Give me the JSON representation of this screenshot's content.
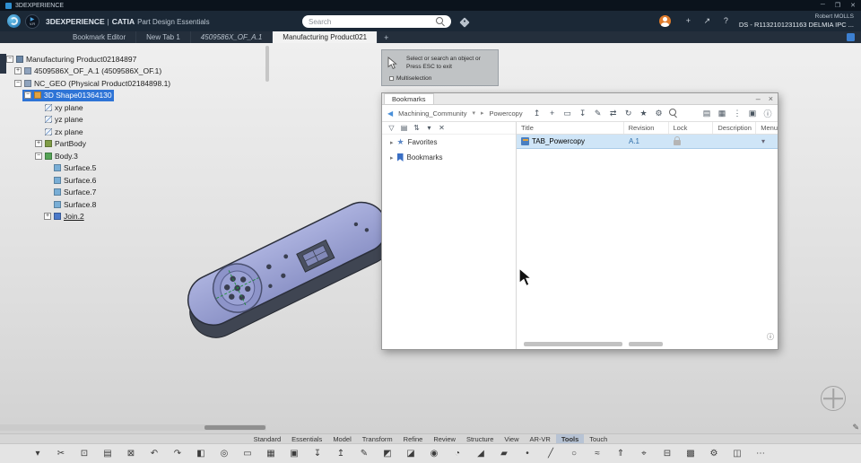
{
  "titlebar": {
    "app_name": "3DEXPERIENCE",
    "minimize": "─",
    "maximize": "❐",
    "close": "✕"
  },
  "header": {
    "brand": "3DEXPERIENCE",
    "divider": "|",
    "app": "CATIA",
    "module": "Part Design Essentials",
    "play_label": "V.R",
    "play_glyph": "▶",
    "search_placeholder": "Search",
    "user_name": "Robert MOLLS",
    "server_id": "DS - R1132101231163 DELMIA IPC ...",
    "actions": [
      {
        "glyph": "+",
        "name": "add-icon"
      },
      {
        "glyph": "↗",
        "name": "share-icon"
      },
      {
        "glyph": "?",
        "name": "help-icon"
      }
    ]
  },
  "tabbar": {
    "tabs": [
      {
        "label": "Bookmark Editor",
        "cls": ""
      },
      {
        "label": "New Tab 1",
        "cls": ""
      },
      {
        "label": "4509586X_OF_A.1",
        "cls": "italic"
      },
      {
        "label": "Manufacturing Product021",
        "cls": "active"
      }
    ],
    "new_tab": "+"
  },
  "tooltip": {
    "line1": "Select or search an object or",
    "line2": "Press ESC to exit",
    "checkbox_label": "Multiselection"
  },
  "tree": {
    "items": [
      {
        "label": "Manufacturing Product02184897",
        "exp": "−",
        "expcls": "box",
        "icon": "ic-root",
        "cls": "lvl0"
      },
      {
        "label": "4509586X_OF_A.1 (4509586X_OF.1)",
        "exp": "+",
        "expcls": "box",
        "icon": "ic-product",
        "cls": "lvl1"
      },
      {
        "label": "NC_GEO (Physical Product02184898.1)",
        "exp": "−",
        "expcls": "box",
        "icon": "ic-product",
        "cls": "lvl1"
      },
      {
        "label": "3D Shape01364130",
        "exp": "−",
        "expcls": "box",
        "icon": "ic-shape",
        "cls": "lvl2 selected"
      },
      {
        "label": "xy plane",
        "exp": "",
        "expcls": "hid",
        "icon": "ic-plane",
        "cls": "lvl3"
      },
      {
        "label": "yz plane",
        "exp": "",
        "expcls": "hid",
        "icon": "ic-plane",
        "cls": "lvl3"
      },
      {
        "label": "zx plane",
        "exp": "",
        "expcls": "hid",
        "icon": "ic-plane",
        "cls": "lvl3"
      },
      {
        "label": "PartBody",
        "exp": "+",
        "expcls": "box",
        "icon": "ic-partbody",
        "cls": "lvl3"
      },
      {
        "label": "Body.3",
        "exp": "−",
        "expcls": "box",
        "icon": "ic-body",
        "cls": "lvl3"
      },
      {
        "label": "Surface.5",
        "exp": "",
        "expcls": "hid",
        "icon": "ic-surface",
        "cls": "lvl4"
      },
      {
        "label": "Surface.6",
        "exp": "",
        "expcls": "hid",
        "icon": "ic-surface",
        "cls": "lvl4"
      },
      {
        "label": "Surface.7",
        "exp": "",
        "expcls": "hid",
        "icon": "ic-surface",
        "cls": "lvl4"
      },
      {
        "label": "Surface.8",
        "exp": "",
        "expcls": "hid",
        "icon": "ic-surface",
        "cls": "lvl4"
      },
      {
        "label": "Join.2",
        "exp": "+",
        "expcls": "box",
        "icon": "ic-join",
        "cls": "lvl4 link"
      }
    ]
  },
  "panel": {
    "title": "Bookmarks",
    "minimize": "–",
    "close": "×",
    "back": "◀",
    "breadcrumb": {
      "root": "Machining_Community",
      "caret": "▾",
      "sep": "▸",
      "current": "Powercopy"
    },
    "toolbar_icons": [
      {
        "glyph": "↥",
        "name": "upload-icon"
      },
      {
        "glyph": "+",
        "name": "add-icon"
      },
      {
        "glyph": "▭",
        "name": "new-folder-icon"
      },
      {
        "glyph": "↧",
        "name": "download-icon"
      },
      {
        "glyph": "✎",
        "name": "edit-icon"
      },
      {
        "glyph": "⇄",
        "name": "transfer-icon"
      },
      {
        "glyph": "↻",
        "name": "refresh-icon"
      },
      {
        "glyph": "★",
        "name": "favorite-icon"
      },
      {
        "glyph": "⚙",
        "name": "settings-icon"
      }
    ],
    "toolbar_icons2": [
      {
        "glyph": "▤",
        "name": "list-view-icon"
      },
      {
        "glyph": "▦",
        "name": "grid-view-icon"
      },
      {
        "glyph": "⋮",
        "name": "more-icon"
      },
      {
        "glyph": "▣",
        "name": "tile-view-icon"
      },
      {
        "glyph": "ⓘ",
        "name": "info-icon"
      }
    ],
    "filter_icons": [
      {
        "glyph": "▽",
        "name": "filter-icon"
      },
      {
        "glyph": "▤",
        "name": "group-icon"
      },
      {
        "glyph": "⇅",
        "name": "sort-icon"
      },
      {
        "glyph": "▾",
        "name": "sort-options-icon"
      },
      {
        "glyph": "✕",
        "name": "clear-filter-icon"
      }
    ],
    "columns": [
      "Title",
      "Revision",
      "Lock",
      "Description",
      "Menu"
    ],
    "nav": [
      {
        "exp": "▸",
        "label": "Favorites"
      },
      {
        "exp": "▸",
        "label": "Bookmarks"
      }
    ],
    "rows": [
      {
        "title": "TAB_Powercopy",
        "revision": "A.1",
        "menu": "▾"
      }
    ],
    "info_glyph": "ⓘ"
  },
  "ribbon": {
    "sections": [
      {
        "label": "Standard",
        "cls": ""
      },
      {
        "label": "Essentials",
        "cls": ""
      },
      {
        "label": "Model",
        "cls": ""
      },
      {
        "label": "Transform",
        "cls": ""
      },
      {
        "label": "Refine",
        "cls": ""
      },
      {
        "label": "Review",
        "cls": ""
      },
      {
        "label": "Structure",
        "cls": ""
      },
      {
        "label": "View",
        "cls": ""
      },
      {
        "label": "AR-VR",
        "cls": ""
      },
      {
        "label": "Tools",
        "cls": "active"
      },
      {
        "label": "Touch",
        "cls": ""
      }
    ]
  },
  "toolbar": {
    "icons": [
      {
        "glyph": "▾",
        "name": "options-chevron-icon"
      },
      {
        "glyph": "✂",
        "name": "cut-icon"
      },
      {
        "glyph": "⊡",
        "name": "copy-icon"
      },
      {
        "glyph": "▤",
        "name": "paste-icon"
      },
      {
        "glyph": "⊠",
        "name": "delete-icon"
      },
      {
        "glyph": "↶",
        "name": "undo-icon"
      },
      {
        "glyph": "↷",
        "name": "redo-icon"
      },
      {
        "glyph": "◧",
        "name": "paint-icon"
      },
      {
        "glyph": "◎",
        "name": "zoom-icon"
      },
      {
        "glyph": "▭",
        "name": "open-icon"
      },
      {
        "glyph": "▦",
        "name": "print-icon"
      },
      {
        "glyph": "▣",
        "name": "save-icon"
      },
      {
        "glyph": "↧",
        "name": "import-icon"
      },
      {
        "glyph": "↥",
        "name": "export-icon"
      },
      {
        "glyph": "✎",
        "name": "sketch-icon"
      },
      {
        "glyph": "◩",
        "name": "pad-icon"
      },
      {
        "glyph": "◪",
        "name": "pocket-icon"
      },
      {
        "glyph": "◉",
        "name": "hole-icon"
      },
      {
        "glyph": "◔",
        "name": "fillet-icon"
      },
      {
        "glyph": "◢",
        "name": "chamfer-icon"
      },
      {
        "glyph": "▰",
        "name": "plane-icon"
      },
      {
        "glyph": "•",
        "name": "point-icon"
      },
      {
        "glyph": "╱",
        "name": "line-icon"
      },
      {
        "glyph": "○",
        "name": "circle-icon"
      },
      {
        "glyph": "≈",
        "name": "spline-icon"
      },
      {
        "glyph": "⇑",
        "name": "extrude-icon"
      },
      {
        "glyph": "⌖",
        "name": "measure-icon"
      },
      {
        "glyph": "⊟",
        "name": "section-icon"
      },
      {
        "glyph": "▩",
        "name": "material-icon"
      },
      {
        "glyph": "⚙",
        "name": "settings-icon"
      },
      {
        "glyph": "◫",
        "name": "view-icon"
      },
      {
        "glyph": "⋯",
        "name": "more-icon"
      }
    ]
  },
  "colors": {
    "accent": "#2e74d6",
    "selection_row": "#cfe5f7",
    "header_bg": "#1b2836",
    "model_top": "#9aa2d6",
    "model_side": "#3f4552"
  }
}
